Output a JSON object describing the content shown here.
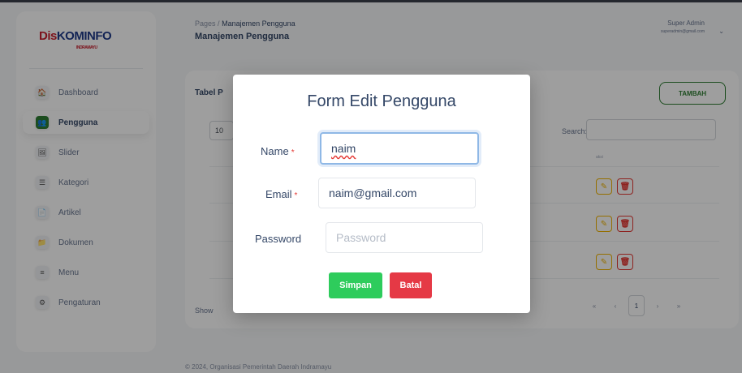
{
  "brand": {
    "part1": "Dis",
    "part2": "KOMINFO",
    "sub": "INDRAMAYU"
  },
  "sidebar": {
    "items": [
      {
        "label": "Dashboard",
        "icon": "🏠"
      },
      {
        "label": "Pengguna",
        "icon": "👥"
      },
      {
        "label": "Slider",
        "icon": "🖼"
      },
      {
        "label": "Kategori",
        "icon": "☰"
      },
      {
        "label": "Artikel",
        "icon": "📄"
      },
      {
        "label": "Dokumen",
        "icon": "📁"
      },
      {
        "label": "Menu",
        "icon": "≡"
      },
      {
        "label": "Pengaturan",
        "icon": "⚙"
      }
    ]
  },
  "header": {
    "breadcrumb_root": "Pages",
    "breadcrumb_sep": "/",
    "breadcrumb_current": "Manajemen Pengguna",
    "page_title": "Manajemen Pengguna",
    "user_name": "Super Admin",
    "user_email": "superadmin@gmail.com"
  },
  "card": {
    "title": "Tabel P",
    "add_button": "TAMBAH",
    "page_length": "10",
    "search_label": "Search:",
    "column_action": "aksi",
    "show_text": "Show",
    "pager": {
      "prev2": "«",
      "prev1": "‹",
      "current": "1",
      "next1": "›",
      "next2": "»"
    }
  },
  "footer": {
    "text": "© 2024, Organisasi Pemerintah Daerah Indramayu"
  },
  "modal": {
    "title": "Form Edit Pengguna",
    "name_label": "Name",
    "name_value": "naim",
    "email_label": "Email",
    "email_value": "naim@gmail.com",
    "password_label": "Password",
    "password_placeholder": "Password",
    "required_mark": "*",
    "save_label": "Simpan",
    "cancel_label": "Batal"
  },
  "colors": {
    "primary": "#2e7d32",
    "save": "#2ecc5c",
    "cancel": "#e53945",
    "required": "#e53935"
  }
}
